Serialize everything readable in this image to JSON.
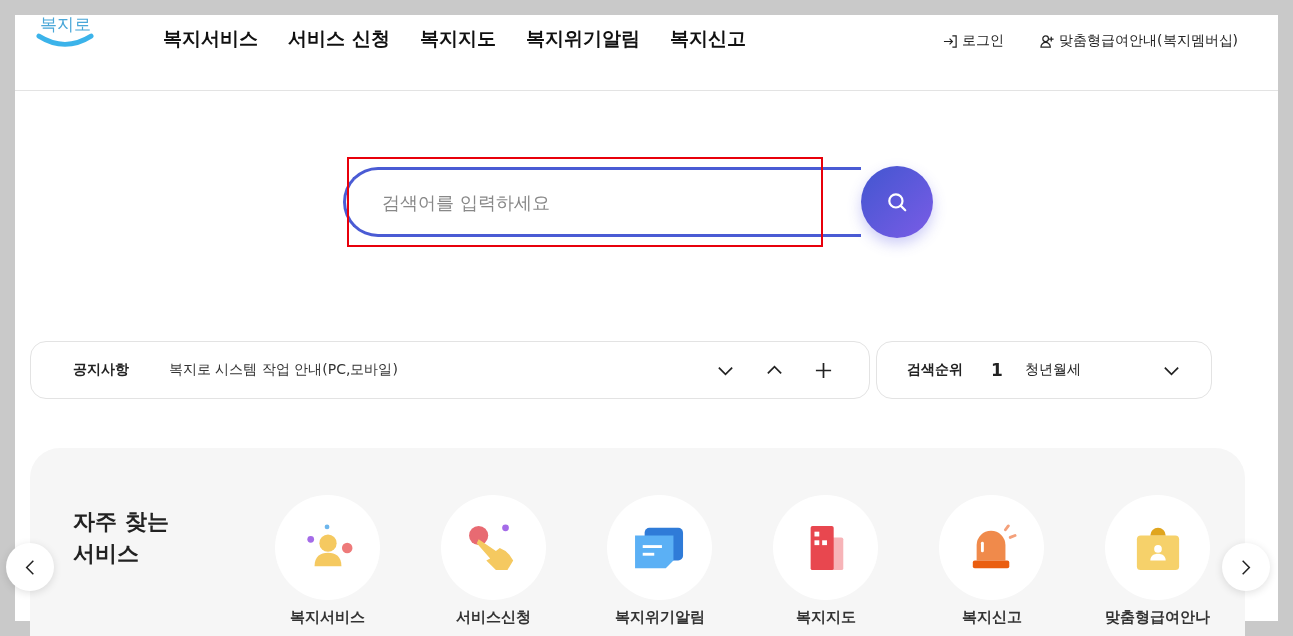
{
  "header": {
    "logo": "복지로",
    "nav": [
      "복지서비스",
      "서비스 신청",
      "복지지도",
      "복지위기알림",
      "복지신고"
    ],
    "login": "로그인",
    "membership": "맞춤형급여안내(복지멤버십)"
  },
  "search": {
    "placeholder": "검색어를 입력하세요",
    "highlighted": true
  },
  "notice": {
    "label": "공지사항",
    "text": "복지로 시스템 작업 안내(PC,모바일)"
  },
  "ranking": {
    "label": "검색순위",
    "rank": "1",
    "term": "청년월세"
  },
  "frequent": {
    "title": "자주 찾는 서비스",
    "items": [
      {
        "kind": "person",
        "label": "복지서비스"
      },
      {
        "kind": "hand",
        "label": "서비스신청"
      },
      {
        "kind": "chat",
        "label": "복지위기알림"
      },
      {
        "kind": "map",
        "label": "복지지도"
      },
      {
        "kind": "siren",
        "label": "복지신고"
      },
      {
        "kind": "badge",
        "label": "맞춤형급여안나"
      }
    ]
  }
}
